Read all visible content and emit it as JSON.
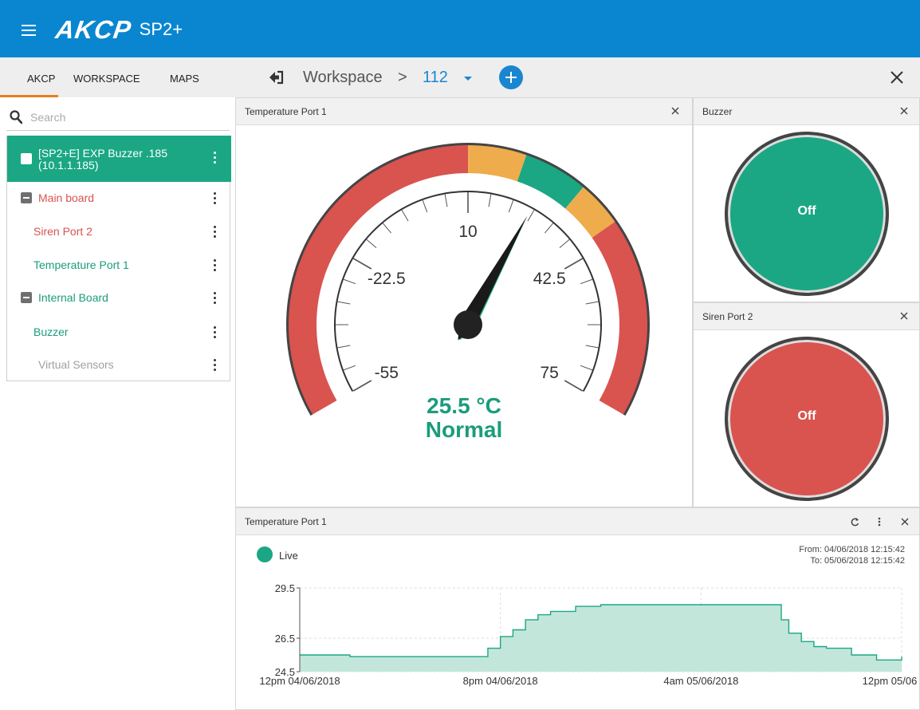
{
  "app": {
    "brand": "AKCP",
    "model": "SP2+"
  },
  "sidebar": {
    "tabs": [
      {
        "label": "AKCP",
        "active": true
      },
      {
        "label": "WORKSPACE",
        "active": false
      },
      {
        "label": "MAPS",
        "active": false
      }
    ],
    "search": {
      "placeholder": "Search",
      "value": ""
    },
    "tree": [
      {
        "label": "[SP2+E] EXP Buzzer .185",
        "label2": "(10.1.1.185)",
        "selected": true,
        "color": "#ffffff"
      },
      {
        "label": "Main board",
        "color": "#d9534f"
      },
      {
        "label": "Siren Port 2",
        "color": "#d9534f"
      },
      {
        "label": "Temperature Port 1",
        "color": "#1b9c7c"
      },
      {
        "label": "Internal Board",
        "color": "#1b9c7c"
      },
      {
        "label": "Buzzer",
        "color": "#1b9c7c"
      },
      {
        "label": "Virtual Sensors",
        "color": "#a0a0a0"
      }
    ]
  },
  "workspace": {
    "crumb": "Workspace",
    "separator": ">",
    "current": "112"
  },
  "widgets": {
    "gauge": {
      "title": "Temperature Port 1",
      "value": "25.5 °C",
      "status": "Normal",
      "scale_labels": [
        "-55",
        "-22.5",
        "10",
        "42.5",
        "75"
      ]
    },
    "buzzer": {
      "title": "Buzzer",
      "state": "Off"
    },
    "siren": {
      "title": "Siren Port 2",
      "state": "Off"
    },
    "graph": {
      "title": "Temperature Port 1",
      "live_label": "Live",
      "from": "From: 04/06/2018 12:15:42",
      "to": "To: 05/06/2018 12:15:42"
    }
  },
  "colors": {
    "topbar": "#0a86d0",
    "accent": "#1ba784",
    "alarm": "#d9534f",
    "warning": "#efac4c",
    "disabled": "#a0a0a0",
    "link": "#1a86d0"
  },
  "chart_data": {
    "type": "area",
    "ylim": [
      24.5,
      29.5
    ],
    "yticks": [
      24.5,
      26.5,
      29.5
    ],
    "xticks": [
      "12pm 04/06/2018",
      "8pm 04/06/2018",
      "4am 05/06/2018",
      "12pm 05/06"
    ],
    "grid": true,
    "series": [
      {
        "color": "#1ba784",
        "x": [
          0,
          1,
          2,
          3,
          4,
          5,
          6,
          7,
          7.5,
          8,
          8.5,
          9,
          9.5,
          10,
          11,
          12,
          13,
          14,
          15,
          16,
          17,
          18,
          19,
          19.2,
          19.5,
          20,
          20.5,
          21,
          22,
          23,
          24
        ],
        "values": [
          25.5,
          25.5,
          25.4,
          25.4,
          25.4,
          25.4,
          25.4,
          25.4,
          25.9,
          26.6,
          27.0,
          27.6,
          27.9,
          28.1,
          28.4,
          28.5,
          28.5,
          28.5,
          28.5,
          28.5,
          28.5,
          28.5,
          28.5,
          27.6,
          26.8,
          26.3,
          26.0,
          25.9,
          25.5,
          25.2,
          25.4
        ]
      }
    ]
  }
}
